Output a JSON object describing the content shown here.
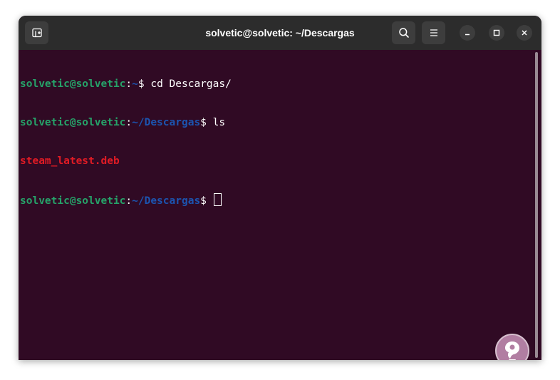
{
  "window": {
    "title": "solvetic@solvetic: ~/Descargas"
  },
  "titlebar": {
    "icons": [
      "new-tab-icon",
      "search-icon",
      "hamburger-menu-icon",
      "minimize-icon",
      "maximize-icon",
      "close-icon"
    ]
  },
  "terminal": {
    "colors": {
      "background": "#300a24",
      "user": "#26a269",
      "path": "#1c54b0",
      "file": "#e01b24",
      "text": "#ffffff"
    },
    "lines": [
      {
        "user": "solvetic@solvetic",
        "sep": ":",
        "path": "~",
        "prompt": "$ ",
        "command": "cd Descargas/"
      },
      {
        "user": "solvetic@solvetic",
        "sep": ":",
        "path": "~/Descargas",
        "prompt": "$ ",
        "command": "ls"
      },
      {
        "output": "steam_latest.deb"
      },
      {
        "user": "solvetic@solvetic",
        "sep": ":",
        "path": "~/Descargas",
        "prompt": "$ ",
        "command": ""
      }
    ]
  },
  "watermark": {
    "icon": "solvetic-logo-icon"
  }
}
